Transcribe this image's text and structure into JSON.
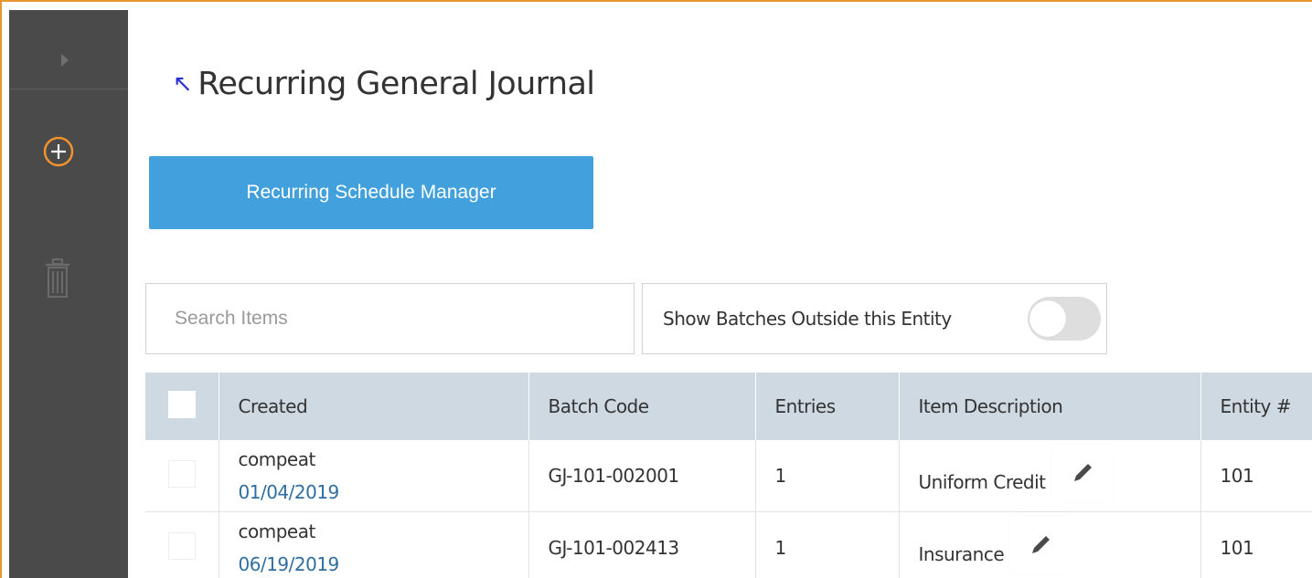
{
  "page": {
    "title": "Recurring General Journal",
    "back_glyph": "↖",
    "accent_color": "#e8962f",
    "primary_color": "#42a0dc"
  },
  "sidebar": {
    "items": [
      {
        "name": "expand-icon"
      },
      {
        "name": "add-icon"
      },
      {
        "name": "trash-icon"
      }
    ]
  },
  "toolbar": {
    "schedule_button_label": "Recurring Schedule Manager"
  },
  "search": {
    "placeholder": "Search Items",
    "value": ""
  },
  "filter": {
    "label": "Show Batches Outside this Entity",
    "toggle_on": false
  },
  "table": {
    "headers": [
      "Created",
      "Batch Code",
      "Entries",
      "Item Description",
      "Entity #"
    ],
    "rows": [
      {
        "user": "compeat",
        "date": "01/04/2019",
        "batch_code": "GJ-101-002001",
        "entries": "1",
        "description": "Uniform Credit",
        "entity": "101"
      },
      {
        "user": "compeat",
        "date": "06/19/2019",
        "batch_code": "GJ-101-002413",
        "entries": "1",
        "description": "Insurance",
        "entity": "101"
      }
    ]
  }
}
